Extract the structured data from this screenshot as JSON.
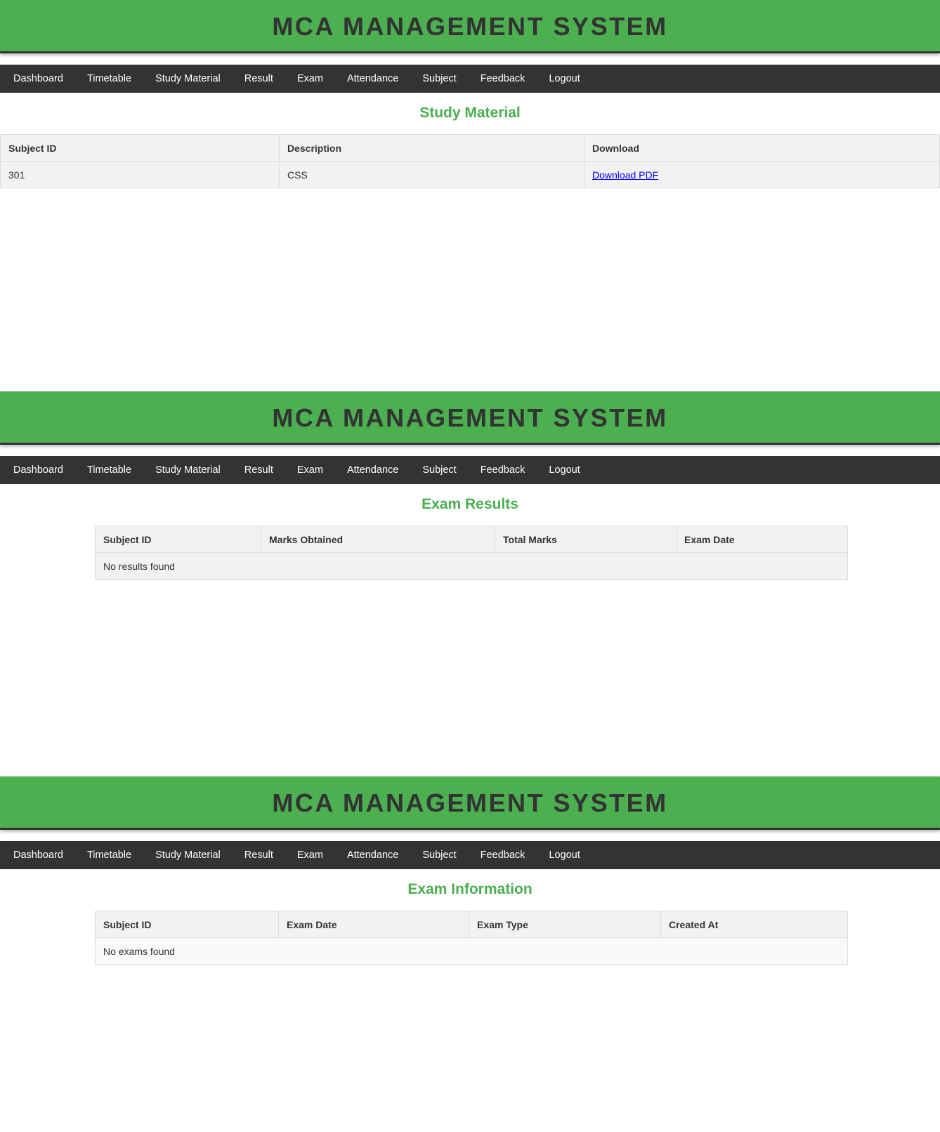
{
  "app_title": "MCA MANAGEMENT SYSTEM",
  "nav": [
    "Dashboard",
    "Timetable",
    "Study Material",
    "Result",
    "Exam",
    "Attendance",
    "Subject",
    "Feedback",
    "Logout"
  ],
  "study_material": {
    "title": "Study Material",
    "columns": [
      "Subject ID",
      "Description",
      "Download"
    ],
    "rows": [
      {
        "subject_id": "301",
        "description": "CSS",
        "download_label": "Download PDF"
      }
    ]
  },
  "exam_results": {
    "title": "Exam Results",
    "columns": [
      "Subject ID",
      "Marks Obtained",
      "Total Marks",
      "Exam Date"
    ],
    "empty_message": "No results found"
  },
  "exam_information": {
    "title": "Exam Information",
    "columns": [
      "Subject ID",
      "Exam Date",
      "Exam Type",
      "Created At"
    ],
    "empty_message": "No exams found"
  },
  "colors": {
    "header_green": "#4caf50",
    "nav_dark": "#333333",
    "title_green": "#4caf50",
    "table_bg": "#f2f2f2",
    "link_blue": "#0000ee"
  }
}
